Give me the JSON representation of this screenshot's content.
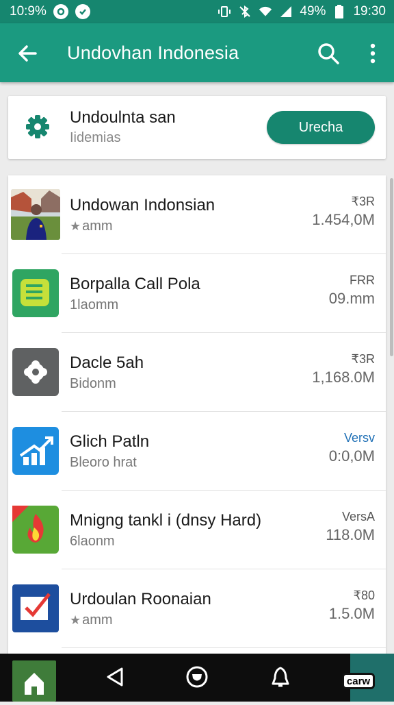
{
  "status_bar": {
    "time_left": "10:9%",
    "battery": "49%",
    "time_right": "19:30"
  },
  "app_bar": {
    "title": "Undovhan Indonesia",
    "icons": [
      "back-arrow-icon",
      "search-icon",
      "more-vert-icon"
    ]
  },
  "header_card": {
    "title": "Undoulnta san",
    "subtitle": "Iidemias",
    "button_label": "Urecha",
    "icon": "gear-icon"
  },
  "apps": [
    {
      "name": "Undowan Indonsian",
      "sub": "amm",
      "sub_star": true,
      "tag": "₹3R",
      "size": "1.454,0M",
      "thumb": "photo-person",
      "tag_color": "#555555"
    },
    {
      "name": "Borpalla Call Pola",
      "sub": "1laomm",
      "sub_star": false,
      "tag": "FRR",
      "size": "09.mm",
      "thumb": "green-doc",
      "tag_color": "#555555"
    },
    {
      "name": "Dacle 5ah",
      "sub": "Bidonm",
      "sub_star": false,
      "tag": "₹3R",
      "size": "1,168.0M",
      "thumb": "gray-camera",
      "tag_color": "#555555"
    },
    {
      "name": "Glich Patln",
      "sub": "Bleoro hrat",
      "sub_star": false,
      "tag": "Versv",
      "size": "0:0,0M",
      "thumb": "blue-chart",
      "tag_color": "#1e6fb5"
    },
    {
      "name": "Mnigng tankl i  (dnsy Hard)",
      "sub": "6laonm",
      "sub_star": false,
      "tag": "VersA",
      "size": "118.0M",
      "thumb": "green-flame",
      "tag_color": "#555555"
    },
    {
      "name": "Urdoulan Roonaian",
      "sub": "amm",
      "sub_star": true,
      "tag": "₹80",
      "size": "1.5.0M",
      "thumb": "blue-check",
      "tag_color": "#555555"
    }
  ],
  "nav_bar": {
    "ext_label": "carw",
    "icons": [
      "home-icon",
      "back-triangle-icon",
      "home-circle-icon",
      "bell-icon"
    ]
  },
  "colors": {
    "status_bar": "#16866f",
    "app_bar": "#1b9a80",
    "accent_button": "#16866f",
    "nav_bar": "#0d0d0d"
  }
}
